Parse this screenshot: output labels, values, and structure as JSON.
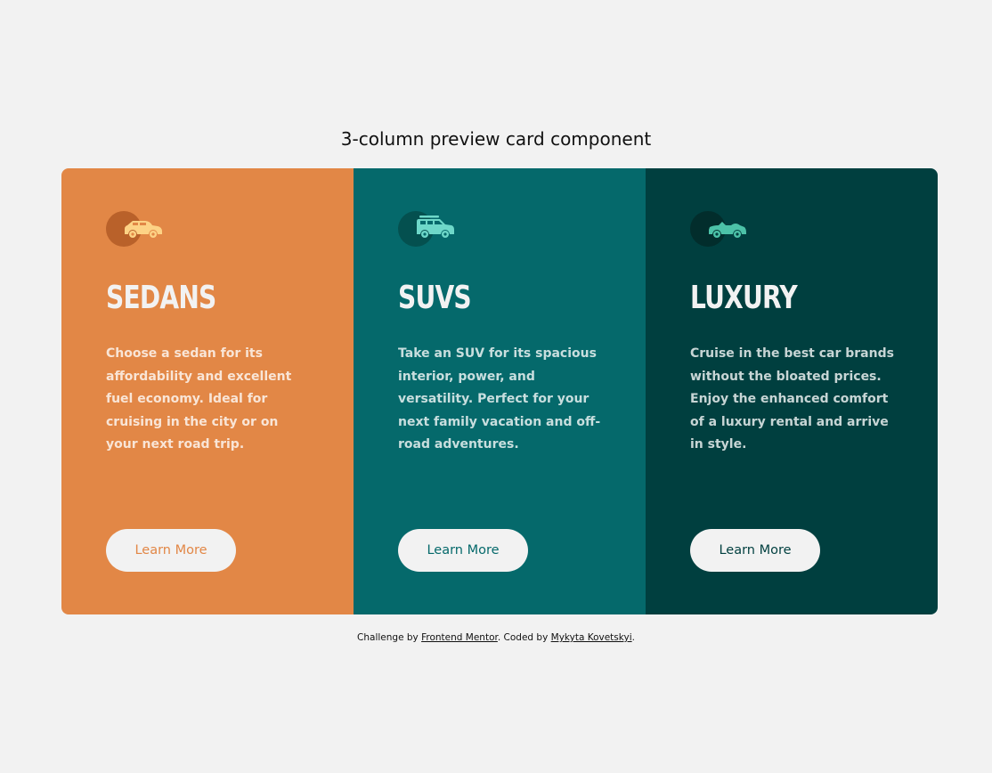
{
  "page": {
    "heading": "3-column preview card component"
  },
  "cards": [
    {
      "id": "sedans",
      "title": "Sedans",
      "text": "Choose a sedan for its affordability and excellent fuel economy. Ideal for cruising in the city or on your next road trip.",
      "button_label": "Learn More",
      "icon": "sedan-car-icon",
      "background": "#e28746"
    },
    {
      "id": "suvs",
      "title": "SUVs",
      "text": "Take an SUV for its spacious interior, power, and versatility. Perfect for your next family vacation and off-road adventures.",
      "button_label": "Learn More",
      "icon": "suv-car-icon",
      "background": "#05696b"
    },
    {
      "id": "luxury",
      "title": "Luxury",
      "text": "Cruise in the best car brands without the bloated prices. Enjoy the enhanced comfort of a luxury rental and arrive in style.",
      "button_label": "Learn More",
      "icon": "luxury-car-icon",
      "background": "#003f3f"
    }
  ],
  "footer": {
    "prefix": "Challenge by ",
    "challenge_link": "Frontend Mentor",
    "middle": ". Coded by ",
    "author_link": "Mykyta Kovetskyi",
    "suffix": "."
  },
  "colors": {
    "page_background": "#f2f2f2",
    "button_background": "#f2f2f2",
    "heading_text": "#f2f2f2"
  }
}
